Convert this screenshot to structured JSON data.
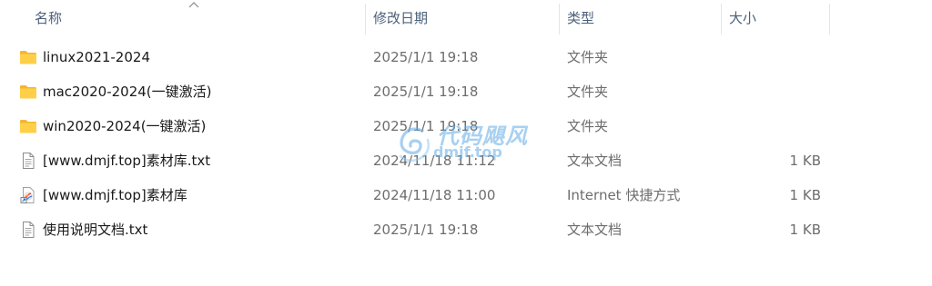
{
  "header": {
    "name": "名称",
    "date": "修改日期",
    "type": "类型",
    "size": "大小"
  },
  "rows": [
    {
      "icon": "folder-icon",
      "name": "linux2021-2024",
      "date": "2025/1/1 19:18",
      "type": "文件夹",
      "size": ""
    },
    {
      "icon": "folder-icon",
      "name": "mac2020-2024(一键激活)",
      "date": "2025/1/1 19:18",
      "type": "文件夹",
      "size": ""
    },
    {
      "icon": "folder-icon",
      "name": "win2020-2024(一键激活)",
      "date": "2025/1/1 19:18",
      "type": "文件夹",
      "size": ""
    },
    {
      "icon": "text-file-icon",
      "name": "[www.dmjf.top]素材库.txt",
      "date": "2024/11/18 11:12",
      "type": "文本文档",
      "size": "1 KB"
    },
    {
      "icon": "internet-shortcut-icon",
      "name": "[www.dmjf.top]素材库",
      "date": "2024/11/18 11:00",
      "type": "Internet 快捷方式",
      "size": "1 KB"
    },
    {
      "icon": "text-file-icon",
      "name": "使用说明文档.txt",
      "date": "2025/1/1 19:18",
      "type": "文本文档",
      "size": "1 KB"
    }
  ],
  "watermark": {
    "title": "代码飓风",
    "url": "dmjf.top"
  },
  "colors": {
    "header_text": "#4c607a",
    "folder": "#ffc83d",
    "meta_text": "#6d6d6d",
    "watermark": "#60aae6"
  }
}
